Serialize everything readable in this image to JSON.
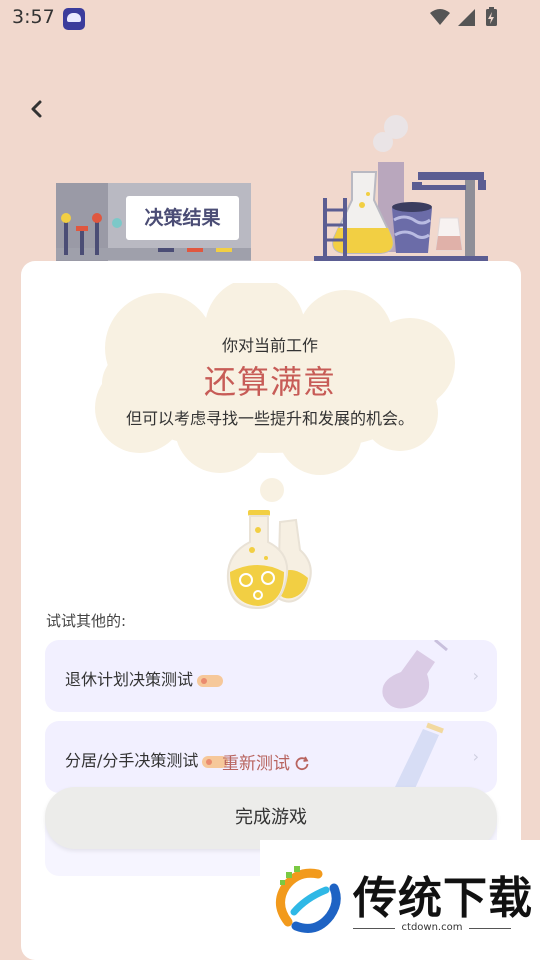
{
  "status_bar": {
    "time": "3:57"
  },
  "header": {
    "banner_label": "决策结果"
  },
  "result": {
    "line1": "你对当前工作",
    "highlight": "还算满意",
    "line3": "但可以考虑寻找一些提升和发展的机会。"
  },
  "more": {
    "label": "试试其他的:",
    "items": [
      {
        "label": "退休计划决策测试"
      },
      {
        "label": "分居/分手决策测试"
      },
      {
        "label": ""
      }
    ]
  },
  "actions": {
    "retest_label": "重新测试",
    "finish_label": "完成游戏"
  },
  "watermark": {
    "title": "传统下载",
    "url": "ctdown.com"
  },
  "colors": {
    "background": "#f1d8cd",
    "accent": "#c75c57",
    "card": "#ffffff"
  }
}
